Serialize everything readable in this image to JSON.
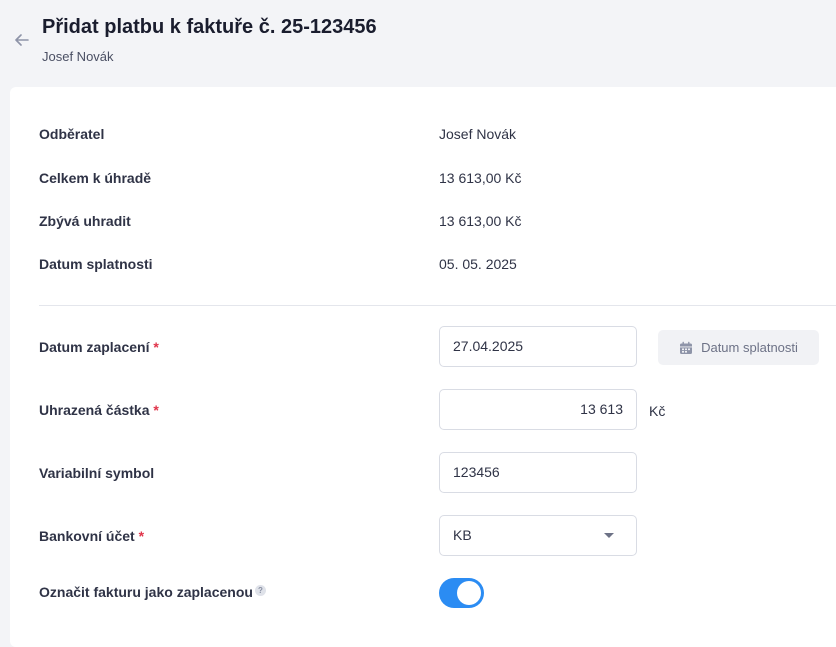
{
  "header": {
    "title": "Přidat platbu k faktuře č. 25-123456",
    "subtitle": "Josef Novák"
  },
  "summary": [
    {
      "label": "Odběratel",
      "value": "Josef Novák"
    },
    {
      "label": "Celkem k úhradě",
      "value": "13 613,00 Kč"
    },
    {
      "label": "Zbývá uhradit",
      "value": "13 613,00 Kč"
    },
    {
      "label": "Datum splatnosti",
      "value": "05. 05. 2025"
    }
  ],
  "form": {
    "required_mark": "*",
    "payment_date": {
      "label": "Datum zaplacení",
      "value": "27.04.2025"
    },
    "due_date_button": {
      "label": "Datum splatnosti",
      "icon": "calendar-icon"
    },
    "amount": {
      "label": "Uhrazená částka",
      "value": "13 613",
      "currency": "Kč"
    },
    "variable_symbol": {
      "label": "Variabilní symbol",
      "value": "123456"
    },
    "bank_account": {
      "label": "Bankovní účet",
      "value": "KB"
    },
    "mark_paid": {
      "label": "Označit fakturu jako zaplacenou",
      "help_icon": "?",
      "checked": true
    }
  },
  "colors": {
    "accent": "#2b8cf3",
    "required": "#e0344a"
  }
}
